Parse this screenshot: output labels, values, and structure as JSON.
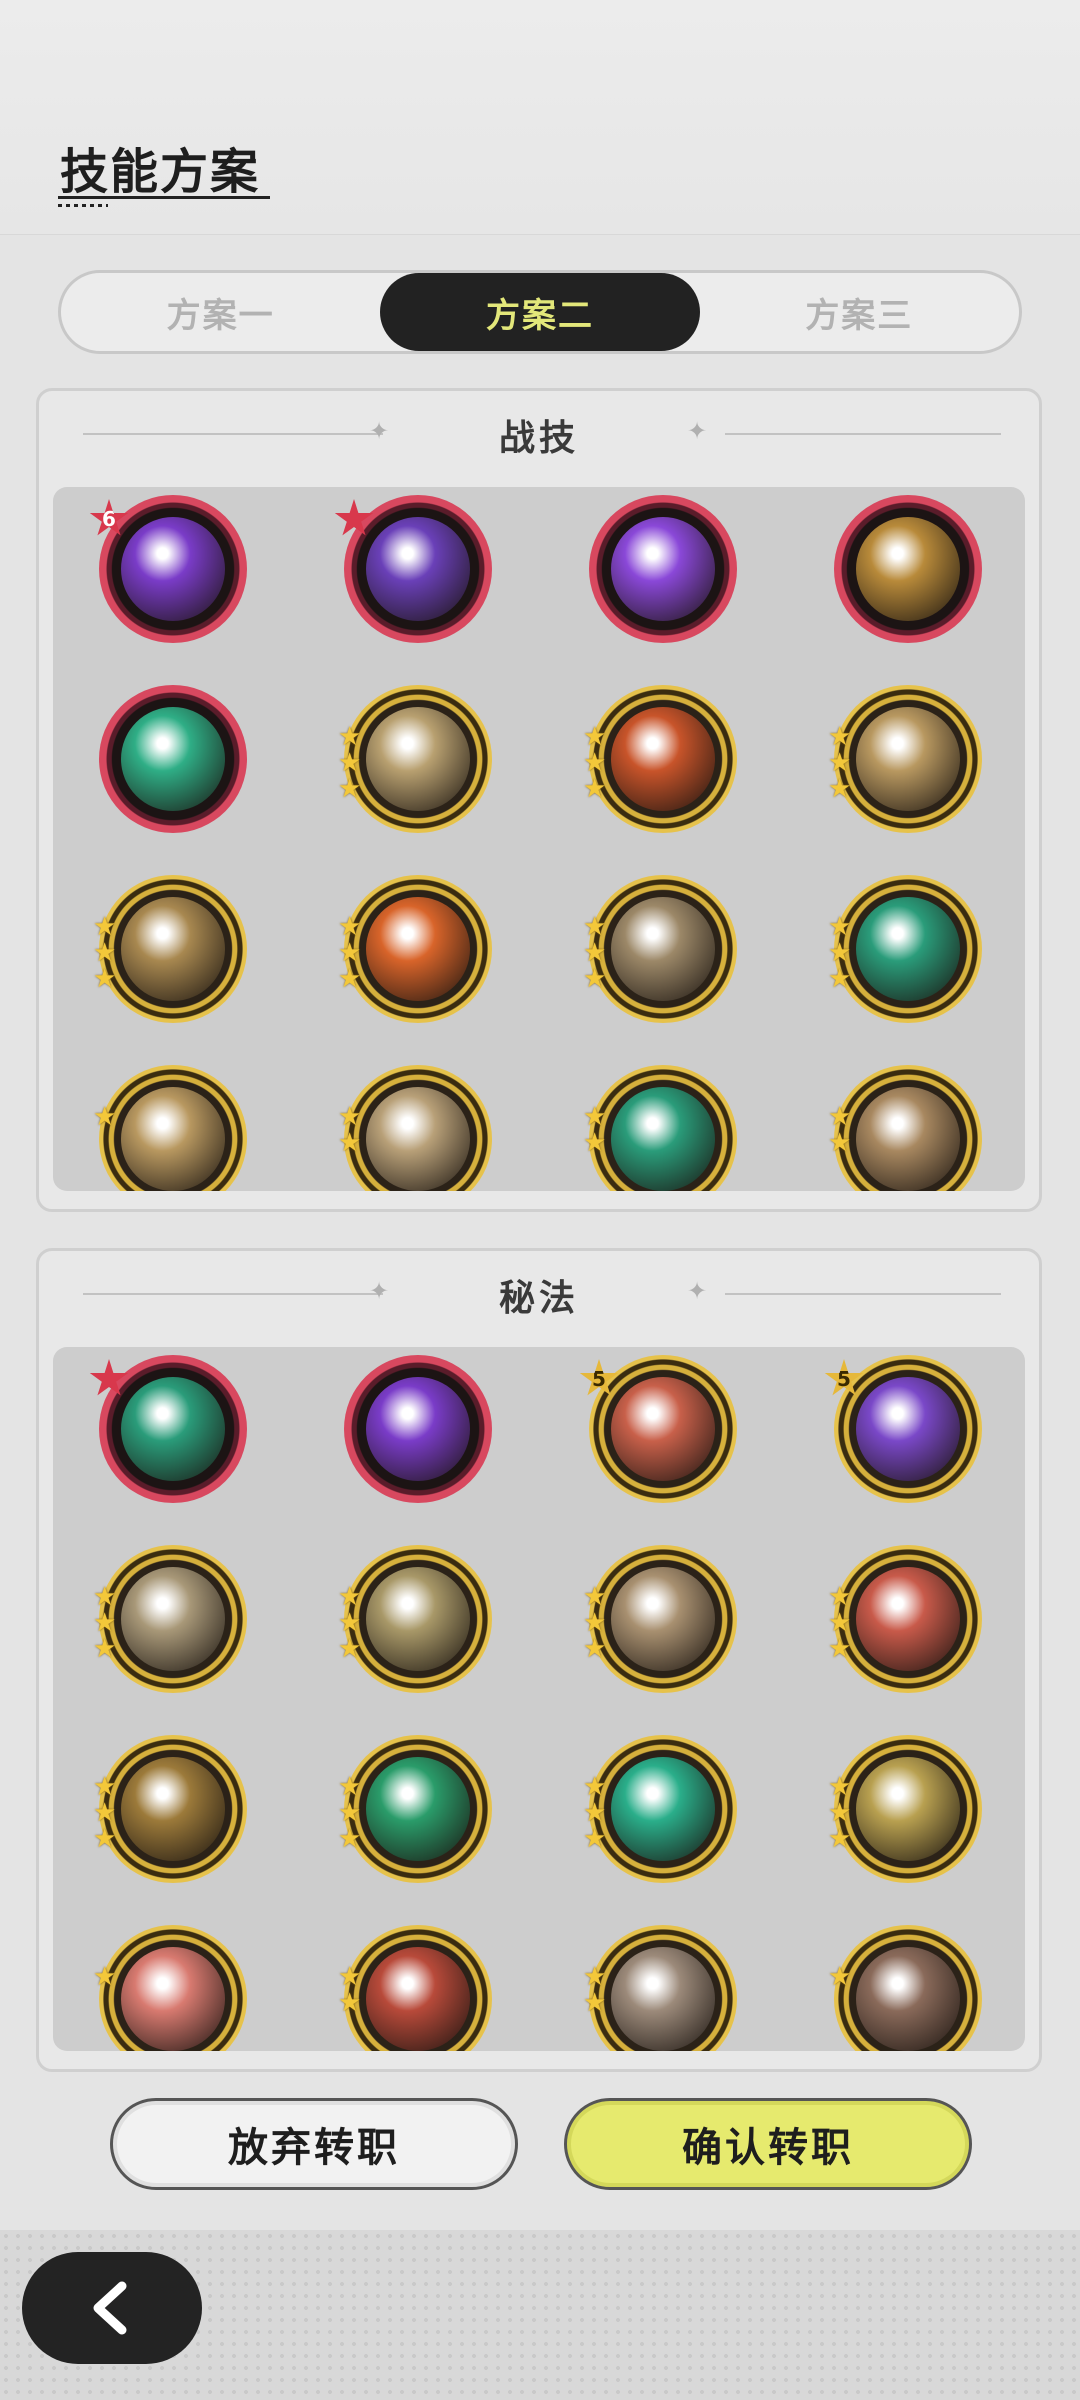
{
  "header": {
    "title": "技能方案"
  },
  "tabs": [
    {
      "label": "方案一",
      "active": false
    },
    {
      "label": "方案二",
      "active": true
    },
    {
      "label": "方案三",
      "active": false
    }
  ],
  "sections": [
    {
      "title": "战技",
      "skills": [
        {
          "icon": "purple-heart-burst-icon",
          "frame": "red",
          "badge": "6",
          "stars": 0,
          "color": "#7a3cc8"
        },
        {
          "icon": "purple-claw-icon",
          "frame": "red",
          "badge": "star",
          "stars": 0,
          "color": "#6a40b8"
        },
        {
          "icon": "purple-vortex-icon",
          "frame": "red",
          "badge": "",
          "stars": 0,
          "color": "#8a48d8"
        },
        {
          "icon": "gold-wave-icon",
          "frame": "red",
          "badge": "",
          "stars": 0,
          "color": "#b88a3a"
        },
        {
          "icon": "green-rising-arrows-icon",
          "frame": "red",
          "badge": "",
          "stars": 0,
          "color": "#2fae86"
        },
        {
          "icon": "gold-hand-swipe-icon",
          "frame": "gold",
          "badge": "",
          "stars": 3,
          "color": "#b8a070"
        },
        {
          "icon": "fire-slash-icon",
          "frame": "gold",
          "badge": "",
          "stars": 3,
          "color": "#c8542a"
        },
        {
          "icon": "gold-shield-strike-icon",
          "frame": "gold",
          "badge": "",
          "stars": 3,
          "color": "#b89860"
        },
        {
          "icon": "gold-diagonal-slash-icon",
          "frame": "gold",
          "badge": "",
          "stars": 3,
          "color": "#a88850"
        },
        {
          "icon": "fire-emblem-icon",
          "frame": "gold",
          "badge": "",
          "stars": 3,
          "color": "#d8642a"
        },
        {
          "icon": "crescent-sword-icon",
          "frame": "gold",
          "badge": "",
          "stars": 3,
          "color": "#9c8868"
        },
        {
          "icon": "green-sword-icon",
          "frame": "gold",
          "badge": "",
          "stars": 3,
          "color": "#2a9c7a"
        },
        {
          "icon": "gold-burst-icon",
          "frame": "gold",
          "badge": "",
          "stars": 1,
          "color": "#b89860"
        },
        {
          "icon": "gold-swirl-icon",
          "frame": "gold",
          "badge": "",
          "stars": 2,
          "color": "#b8a078"
        },
        {
          "icon": "green-dash-icon",
          "frame": "gold",
          "badge": "",
          "stars": 2,
          "color": "#2a9c7a"
        },
        {
          "icon": "gold-spikes-icon",
          "frame": "gold",
          "badge": "",
          "stars": 2,
          "color": "#a88860"
        }
      ]
    },
    {
      "title": "秘法",
      "skills": [
        {
          "icon": "green-heal-circle-icon",
          "frame": "red",
          "badge": "star",
          "stars": 0,
          "color": "#2a9c7a"
        },
        {
          "icon": "purple-flame-icon",
          "frame": "red",
          "badge": "",
          "stars": 0,
          "color": "#7a3cc8"
        },
        {
          "icon": "red-fist-icon",
          "frame": "gold",
          "badge": "5",
          "stars": 0,
          "color": "#c8604a"
        },
        {
          "icon": "purple-figure-icon",
          "frame": "gold",
          "badge": "5",
          "stars": 0,
          "color": "#7a48c8"
        },
        {
          "icon": "leaf-crest-icon",
          "frame": "gold",
          "badge": "",
          "stars": 3,
          "color": "#a89878"
        },
        {
          "icon": "golem-icon",
          "frame": "gold",
          "badge": "",
          "stars": 3,
          "color": "#a89868"
        },
        {
          "icon": "boot-icon",
          "frame": "gold",
          "badge": "",
          "stars": 3,
          "color": "#a89070"
        },
        {
          "icon": "red-rock-icon",
          "frame": "gold",
          "badge": "",
          "stars": 3,
          "color": "#c85a4a"
        },
        {
          "icon": "armor-icon",
          "frame": "gold",
          "badge": "",
          "stars": 3,
          "color": "#9c7a3a"
        },
        {
          "icon": "green-heart-icon",
          "frame": "gold",
          "badge": "",
          "stars": 3,
          "color": "#2a9c6a"
        },
        {
          "icon": "green-blade-icon",
          "frame": "gold",
          "badge": "",
          "stars": 3,
          "color": "#2aae8a"
        },
        {
          "icon": "moon-cross-icon",
          "frame": "gold",
          "badge": "",
          "stars": 3,
          "color": "#b8a050"
        },
        {
          "icon": "red-sword-heal-icon",
          "frame": "gold",
          "badge": "",
          "stars": 1,
          "color": "#d87a70"
        },
        {
          "icon": "red-knight-icon",
          "frame": "gold",
          "badge": "",
          "stars": 2,
          "color": "#b84a3a"
        },
        {
          "icon": "dagger-icon",
          "frame": "gold",
          "badge": "",
          "stars": 2,
          "color": "#9c8a7a"
        },
        {
          "icon": "heart-shield-icon",
          "frame": "gold",
          "badge": "",
          "stars": 1,
          "color": "#8a6a5a"
        }
      ]
    }
  ],
  "buttons": {
    "cancel": "放弃转职",
    "confirm": "确认转职"
  },
  "nav": {
    "back_icon": "chevron-left-icon"
  }
}
